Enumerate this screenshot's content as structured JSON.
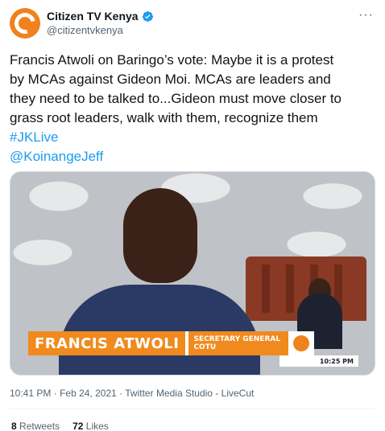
{
  "author": {
    "display_name": "Citizen TV Kenya",
    "handle": "@citizentvkenya",
    "verified": true,
    "avatar_icon": "citizen-tv-logo",
    "brand_color": "#f0821e"
  },
  "menu_icon": "more-dots-icon",
  "more_label": "···",
  "tweet": {
    "lines": [
      "Francis Atwoli on Baringo’s vote: Maybe it is a protest",
      "by MCAs against Gideon Moi. MCAs are leaders and",
      "they need to be talked to...Gideon must move closer to",
      "grass root leaders, walk with them, recognize them"
    ],
    "hashtag": "#JKLive",
    "mention": "@KoinangeJeff",
    "link_color": "#1d9bf0"
  },
  "media": {
    "lower_third_name": "FRANCIS ATWOLI",
    "lower_third_title_1": "SECRETARY GENERAL",
    "lower_third_title_2": "COTU",
    "clock": "10:25 PM"
  },
  "meta": {
    "time": "10:41 PM",
    "date": "Feb 24, 2021",
    "source": "Twitter Media Studio - LiveCut",
    "separator": "·"
  },
  "stats": {
    "retweets_count": "8",
    "retweets_label": "Retweets",
    "likes_count": "72",
    "likes_label": "Likes"
  }
}
